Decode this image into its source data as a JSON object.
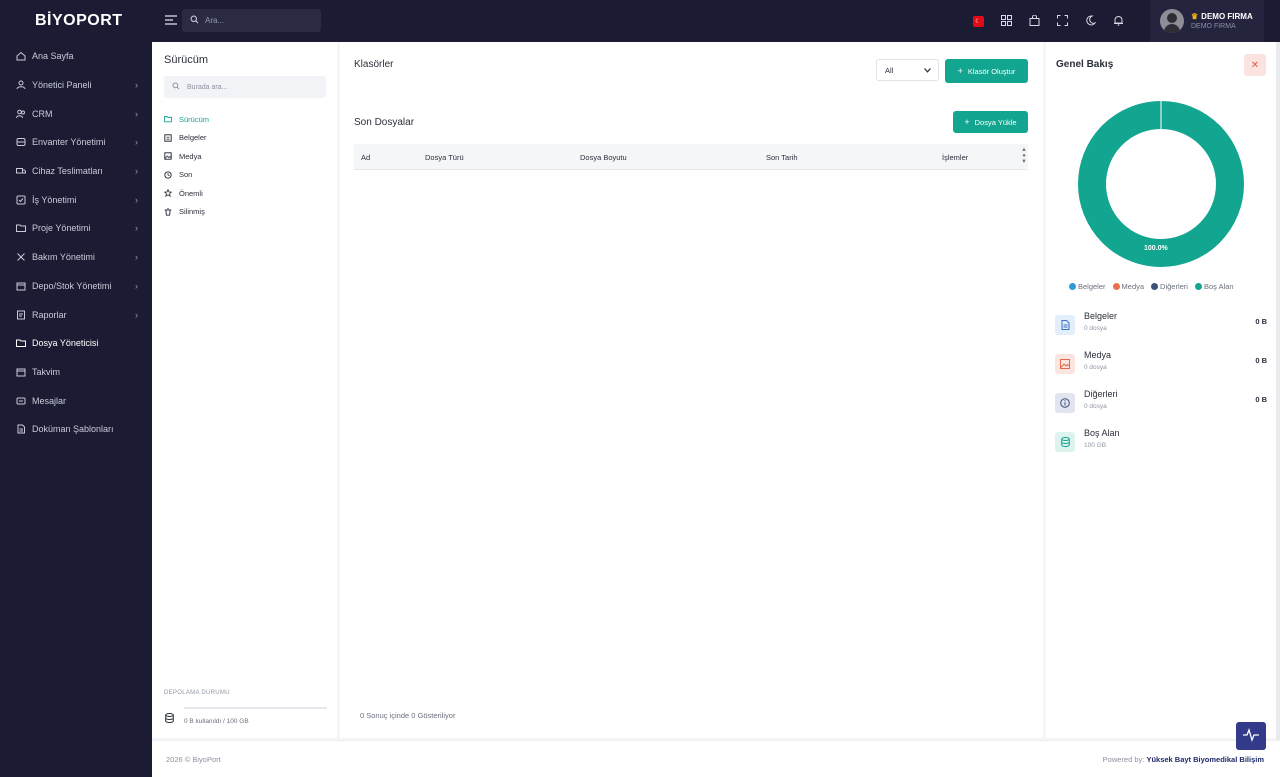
{
  "app": {
    "logo": "BİYOPORT"
  },
  "sidebar": {
    "items": [
      {
        "label": "Ana Sayfa",
        "icon": "home-icon",
        "chevron": false,
        "active": false
      },
      {
        "label": "Yönetici Paneli",
        "icon": "user-admin-icon",
        "chevron": true,
        "active": false
      },
      {
        "label": "CRM",
        "icon": "users-icon",
        "chevron": true,
        "active": false
      },
      {
        "label": "Envanter Yönetimi",
        "icon": "database-icon",
        "chevron": true,
        "active": false
      },
      {
        "label": "Cihaz Teslimatları",
        "icon": "truck-icon",
        "chevron": true,
        "active": false
      },
      {
        "label": "İş Yönetimi",
        "icon": "checkbox-icon",
        "chevron": true,
        "active": false
      },
      {
        "label": "Proje Yönetimi",
        "icon": "folder-icon",
        "chevron": true,
        "active": false
      },
      {
        "label": "Bakım Yönetimi",
        "icon": "tools-icon",
        "chevron": true,
        "active": false
      },
      {
        "label": "Depo/Stok Yönetimi",
        "icon": "box-icon",
        "chevron": true,
        "active": false
      },
      {
        "label": "Raporlar",
        "icon": "report-icon",
        "chevron": true,
        "active": false
      },
      {
        "label": "Dosya Yöneticisi",
        "icon": "folder-icon",
        "chevron": false,
        "active": true
      },
      {
        "label": "Takvim",
        "icon": "calendar-icon",
        "chevron": false,
        "active": false
      },
      {
        "label": "Mesajlar",
        "icon": "message-icon",
        "chevron": false,
        "active": false
      },
      {
        "label": "Doküman Şablonları",
        "icon": "document-icon",
        "chevron": false,
        "active": false
      }
    ]
  },
  "topbar": {
    "search_placeholder": "Ara...",
    "user_name": "DEMO FIRMA",
    "user_sub": "DEMO FIRMA"
  },
  "drive": {
    "title": "Sürücüm",
    "search_placeholder": "Burada ara...",
    "items": [
      {
        "label": "Sürücüm",
        "icon": "drive-icon",
        "active": true
      },
      {
        "label": "Belgeler",
        "icon": "document-icon",
        "active": false
      },
      {
        "label": "Medya",
        "icon": "image-icon",
        "active": false
      },
      {
        "label": "Son",
        "icon": "clock-icon",
        "active": false
      },
      {
        "label": "Önemli",
        "icon": "star-icon",
        "active": false
      },
      {
        "label": "Silinmiş",
        "icon": "trash-icon",
        "active": false
      }
    ],
    "storage_title": "DEPOLAMA DURUMU",
    "storage_text": "0 B kullanıldı / 100 GB",
    "storage_used_fraction": 0
  },
  "main": {
    "folders_title": "Klasörler",
    "filter_value": "All",
    "create_folder_label": "Klasör Oluştur",
    "recent_title": "Son Dosyalar",
    "upload_label": "Dosya Yükle",
    "columns": [
      "Ad",
      "Dosya Türü",
      "Dosya Boyutu",
      "Son Tarih",
      "İşlemler"
    ],
    "showing_text": "0 Sonuç içinde 0 Gösteriliyor"
  },
  "overview": {
    "title": "Genel Bakış",
    "donut_label": "100.0%",
    "legend": [
      {
        "label": "Belgeler",
        "color": "#2e9ad6"
      },
      {
        "label": "Medya",
        "color": "#e8704f"
      },
      {
        "label": "Diğerleri",
        "color": "#3d4f7a"
      },
      {
        "label": "Boş Alan",
        "color": "#12a590"
      }
    ],
    "categories": [
      {
        "name": "Belgeler",
        "count": "0 dosya",
        "size": "0 B",
        "icon": "document-icon",
        "bg": "#e3eefb",
        "fg": "#3b6fc4"
      },
      {
        "name": "Medya",
        "count": "0 dosya",
        "size": "0 B",
        "icon": "image-icon",
        "bg": "#fbe5e0",
        "fg": "#e26a4c"
      },
      {
        "name": "Diğerleri",
        "count": "0 dosya",
        "size": "0 B",
        "icon": "info-icon",
        "bg": "#e2e5ef",
        "fg": "#3d4f7a"
      },
      {
        "name": "Boş Alan",
        "count": "100 GB",
        "size": "",
        "icon": "database-icon",
        "bg": "#dcf3ee",
        "fg": "#12a590"
      }
    ]
  },
  "footer": {
    "copyright": "2026 © BiyoPort",
    "powered_prefix": "Powered by:",
    "powered_name": "Yüksek Bayt Biyomedikal Bilişim"
  }
}
